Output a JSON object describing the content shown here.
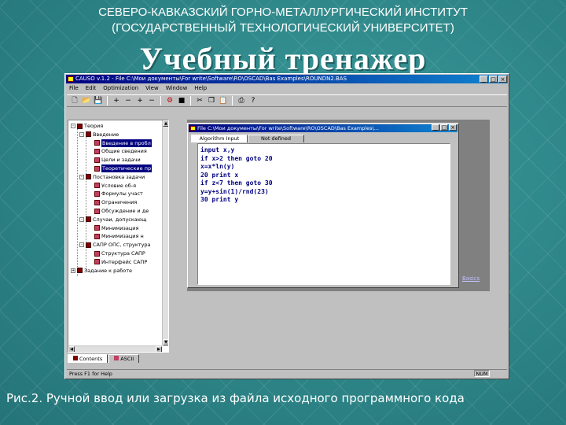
{
  "header": {
    "line1": "СЕВЕРО-КАВКАЗСКИЙ ГОРНО-МЕТАЛЛУРГИЧЕСКИЙ ИНСТИТУТ",
    "line2": "(ГОСУДАРСТВЕННЫЙ ТЕХНОЛОГИЧЕСКИЙ УНИВЕРСИТЕТ)",
    "title": "Учебный тренажер"
  },
  "app": {
    "window_title": "CAUSO v.1.2 - File C:\\Мои документы\\For write\\Software\\RO\\OSCAD\\Bas Examples\\ROUNDN2.BAS",
    "controls": {
      "minimize": "_",
      "maximize": "□",
      "close": "×"
    },
    "menu": [
      "File",
      "Edit",
      "Optimization",
      "View",
      "Window",
      "Help"
    ],
    "tree": [
      {
        "label": "Теория",
        "level": 0,
        "expander": "-",
        "icon": "book",
        "highlight": false
      },
      {
        "label": "Введение",
        "level": 1,
        "expander": "-",
        "icon": "book",
        "highlight": false
      },
      {
        "label": "Введение в пробл",
        "level": 2,
        "expander": "",
        "icon": "page",
        "highlight": true
      },
      {
        "label": "Общие сведения",
        "level": 2,
        "expander": "",
        "icon": "page",
        "highlight": false
      },
      {
        "label": "Цели и задачи",
        "level": 2,
        "expander": "",
        "icon": "page",
        "highlight": false
      },
      {
        "label": "Теоретические пр",
        "level": 2,
        "expander": "",
        "icon": "page",
        "highlight": true
      },
      {
        "label": "Постановка задачи",
        "level": 1,
        "expander": "-",
        "icon": "book",
        "highlight": false
      },
      {
        "label": "Условие об-я",
        "level": 2,
        "expander": "",
        "icon": "page",
        "highlight": false
      },
      {
        "label": "Формулы участ",
        "level": 2,
        "expander": "",
        "icon": "page",
        "highlight": false
      },
      {
        "label": "Ограничения",
        "level": 2,
        "expander": "",
        "icon": "page",
        "highlight": false
      },
      {
        "label": "Обсуждение и де",
        "level": 2,
        "expander": "",
        "icon": "page",
        "highlight": false
      },
      {
        "label": "Случаи, допускающ",
        "level": 1,
        "expander": "-",
        "icon": "book",
        "highlight": false
      },
      {
        "label": "Минимизация",
        "level": 2,
        "expander": "",
        "icon": "page",
        "highlight": false
      },
      {
        "label": "Минимизация н",
        "level": 2,
        "expander": "",
        "icon": "page",
        "highlight": false
      },
      {
        "label": "САПР ОПС, структура",
        "level": 1,
        "expander": "-",
        "icon": "book",
        "highlight": false
      },
      {
        "label": "Структура САПР",
        "level": 2,
        "expander": "",
        "icon": "page",
        "highlight": false
      },
      {
        "label": "Интерфейс САПР",
        "level": 2,
        "expander": "",
        "icon": "page",
        "highlight": false
      },
      {
        "label": "Задание к работе",
        "level": 0,
        "expander": "+",
        "icon": "book",
        "highlight": false
      }
    ],
    "bottom_tabs": [
      "Contents",
      "ASCII"
    ],
    "status_text": "Press F1 for Help",
    "status_indicator": "NUM",
    "link_text": "Basics"
  },
  "editor": {
    "window_title": "File C:\\Мои документы\\For write\\Software\\RO\\OSCAD\\Bas Examples\\...",
    "tabs": [
      "Algorithm Input",
      "Not defined"
    ],
    "code_lines": [
      "input x,y",
      "if x>2 then goto 20",
      "x=x*ln(y)",
      "20 print x",
      "if z<7 then goto 30",
      "y=y+sin(1)/rnd(23)",
      "30 print y"
    ]
  },
  "caption": "Рис.2. Ручной ввод или загрузка из файла исходного программного кода",
  "colors": {
    "background": "#2f8a8c",
    "titlebar_start": "#000080",
    "titlebar_end": "#1084d0",
    "window_face": "#c0c0c0",
    "mdi_bg": "#808080"
  }
}
